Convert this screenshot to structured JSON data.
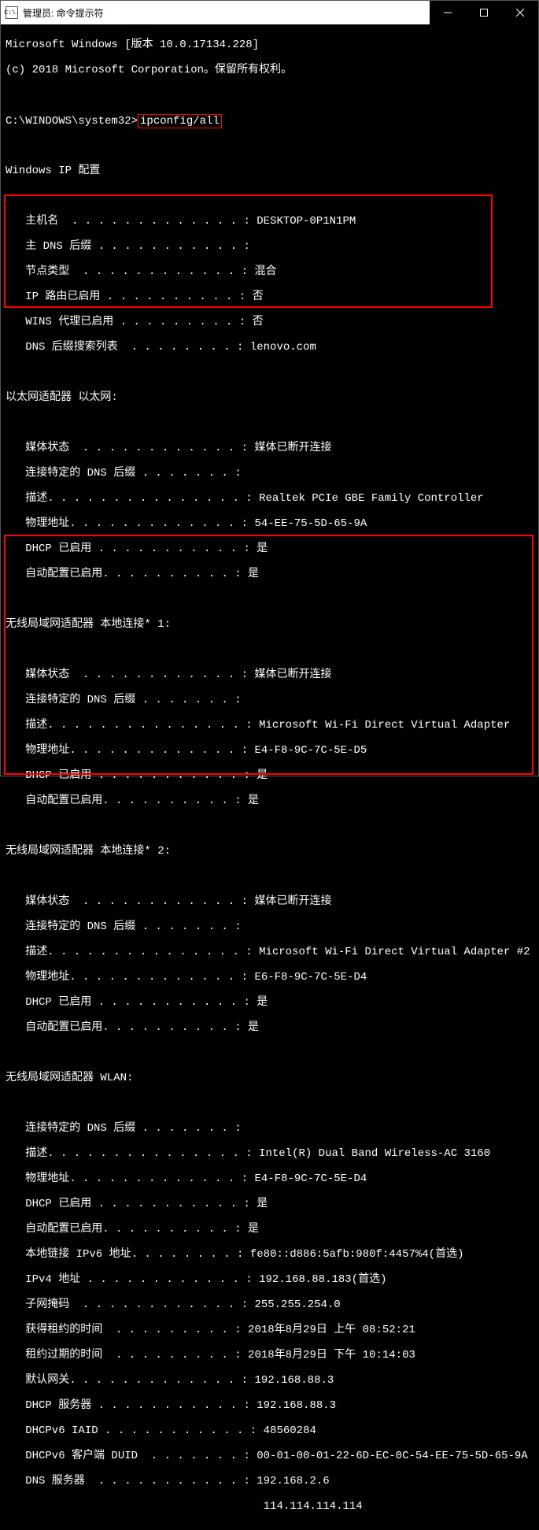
{
  "window": {
    "icon_text": "C:\\.",
    "title": "管理员: 命令提示符",
    "min_tip": "最小化",
    "max_tip": "最大化",
    "close_tip": "关闭"
  },
  "header": {
    "line1": "Microsoft Windows [版本 10.0.17134.228]",
    "line2": "(c) 2018 Microsoft Corporation。保留所有权利。"
  },
  "prompt": {
    "path": "C:\\WINDOWS\\system32>",
    "command": "ipconfig/all"
  },
  "conf_title": "Windows IP 配置",
  "conf": {
    "hostname_lbl": "   主机名  . . . . . . . . . . . . . : ",
    "hostname_val": "DESKTOP-0P1N1PM",
    "dnssuf_lbl": "   主 DNS 后缀 . . . . . . . . . . . : ",
    "dnssuf_val": "",
    "nodetype_lbl": "   节点类型  . . . . . . . . . . . . : ",
    "nodetype_val": "混合",
    "iprt_lbl": "   IP 路由已启用 . . . . . . . . . . : ",
    "iprt_val": "否",
    "wins_lbl": "   WINS 代理已启用 . . . . . . . . . : ",
    "wins_val": "否",
    "dnssl_lbl": "   DNS 后缀搜索列表  . . . . . . . . : ",
    "dnssl_val": "lenovo.com"
  },
  "eth": {
    "title": "以太网适配器 以太网:",
    "media_lbl": "   媒体状态  . . . . . . . . . . . . : ",
    "media_val": "媒体已断开连接",
    "cdns_lbl": "   连接特定的 DNS 后缀 . . . . . . . : ",
    "cdns_val": "",
    "desc_lbl": "   描述. . . . . . . . . . . . . . . : ",
    "desc_val": "Realtek PCIe GBE Family Controller",
    "phys_lbl": "   物理地址. . . . . . . . . . . . . : ",
    "phys_val": "54-EE-75-5D-65-9A",
    "dhcp_lbl": "   DHCP 已启用 . . . . . . . . . . . : ",
    "dhcp_val": "是",
    "auto_lbl": "   自动配置已启用. . . . . . . . . . : ",
    "auto_val": "是"
  },
  "w1": {
    "title": "无线局域网适配器 本地连接* 1:",
    "media_lbl": "   媒体状态  . . . . . . . . . . . . : ",
    "media_val": "媒体已断开连接",
    "cdns_lbl": "   连接特定的 DNS 后缀 . . . . . . . : ",
    "cdns_val": "",
    "desc_lbl": "   描述. . . . . . . . . . . . . . . : ",
    "desc_val": "Microsoft Wi-Fi Direct Virtual Adapter",
    "phys_lbl": "   物理地址. . . . . . . . . . . . . : ",
    "phys_val": "E4-F8-9C-7C-5E-D5",
    "dhcp_lbl": "   DHCP 已启用 . . . . . . . . . . . : ",
    "dhcp_val": "是",
    "auto_lbl": "   自动配置已启用. . . . . . . . . . : ",
    "auto_val": "是"
  },
  "w2": {
    "title": "无线局域网适配器 本地连接* 2:",
    "media_lbl": "   媒体状态  . . . . . . . . . . . . : ",
    "media_val": "媒体已断开连接",
    "cdns_lbl": "   连接特定的 DNS 后缀 . . . . . . . : ",
    "cdns_val": "",
    "desc_lbl": "   描述. . . . . . . . . . . . . . . : ",
    "desc_val": "Microsoft Wi-Fi Direct Virtual Adapter #2",
    "phys_lbl": "   物理地址. . . . . . . . . . . . . : ",
    "phys_val": "E6-F8-9C-7C-5E-D4",
    "dhcp_lbl": "   DHCP 已启用 . . . . . . . . . . . : ",
    "dhcp_val": "是",
    "auto_lbl": "   自动配置已启用. . . . . . . . . . : ",
    "auto_val": "是"
  },
  "wlan": {
    "title": "无线局域网适配器 WLAN:",
    "cdns_lbl": "   连接特定的 DNS 后缀 . . . . . . . : ",
    "cdns_val": "",
    "desc_lbl": "   描述. . . . . . . . . . . . . . . : ",
    "desc_val": "Intel(R) Dual Band Wireless-AC 3160",
    "phys_lbl": "   物理地址. . . . . . . . . . . . . : ",
    "phys_val": "E4-F8-9C-7C-5E-D4",
    "dhcp_lbl": "   DHCP 已启用 . . . . . . . . . . . : ",
    "dhcp_val": "是",
    "auto_lbl": "   自动配置已启用. . . . . . . . . . : ",
    "auto_val": "是",
    "ll6_lbl": "   本地链接 IPv6 地址. . . . . . . . : ",
    "ll6_val": "fe80::d886:5afb:980f:4457%4(首选)",
    "ip4_lbl": "   IPv4 地址 . . . . . . . . . . . . : ",
    "ip4_val": "192.168.88.183(首选)",
    "mask_lbl": "   子网掩码  . . . . . . . . . . . . : ",
    "mask_val": "255.255.254.0",
    "lease_lbl": "   获得租约的时间  . . . . . . . . . : ",
    "lease_val": "2018年8月29日 上午 08:52:21",
    "exp_lbl": "   租约过期的时间  . . . . . . . . . : ",
    "exp_val": "2018年8月29日 下午 10:14:03",
    "gw_lbl": "   默认网关. . . . . . . . . . . . . : ",
    "gw_val": "192.168.88.3",
    "dsrv_lbl": "   DHCP 服务器 . . . . . . . . . . . : ",
    "dsrv_val": "192.168.88.3",
    "iaid_lbl": "   DHCPv6 IAID . . . . . . . . . . . : ",
    "iaid_val": "48560284",
    "duid_lbl": "   DHCPv6 客户端 DUID  . . . . . . . : ",
    "duid_val": "00-01-00-01-22-6D-EC-0C-54-EE-75-5D-65-9A",
    "dns_lbl": "   DNS 服务器  . . . . . . . . . . . : ",
    "dns_val": "192.168.2.6",
    "dns2_lbl": "                                       ",
    "dns2_val": "114.114.114.114"
  }
}
